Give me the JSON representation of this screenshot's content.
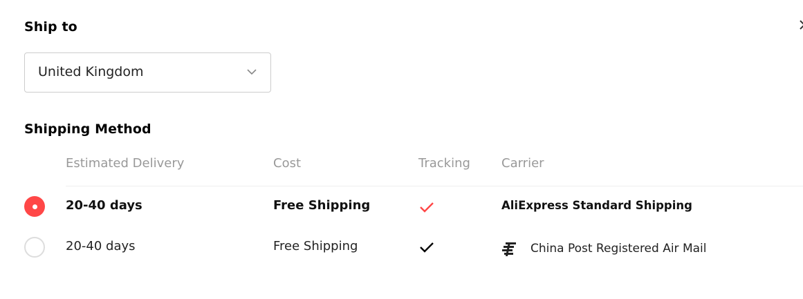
{
  "ship_to": {
    "title": "Ship to",
    "selected_country": "United Kingdom"
  },
  "shipping_method": {
    "title": "Shipping Method",
    "columns": {
      "delivery": "Estimated Delivery",
      "cost": "Cost",
      "tracking": "Tracking",
      "carrier": "Carrier"
    },
    "options": [
      {
        "selected": true,
        "delivery": "20-40 days",
        "cost": "Free Shipping",
        "tracking": true,
        "carrier": "AliExpress Standard Shipping"
      },
      {
        "selected": false,
        "delivery": "20-40 days",
        "cost": "Free Shipping",
        "tracking": true,
        "carrier": "China Post Registered Air Mail",
        "carrier_icon": "china-post-logo-icon"
      }
    ]
  },
  "colors": {
    "accent": "#ff4747",
    "check_selected": "#ff4747",
    "check_default": "#000000",
    "header_text": "#999999"
  }
}
